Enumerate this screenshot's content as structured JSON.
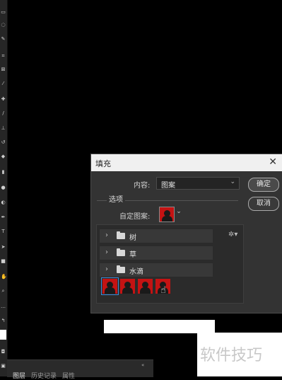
{
  "dialog": {
    "title": "填充",
    "content_label": "内容:",
    "content_value": "图案",
    "ok_label": "确定",
    "cancel_label": "取消",
    "options_label": "选项",
    "custom_pattern_label": "自定图案:",
    "folders": [
      "树",
      "草",
      "水滴"
    ],
    "pattern_count": 4
  },
  "bottom_panel": {
    "tabs": [
      "图层",
      "历史记录",
      "属性"
    ]
  },
  "watermark": {
    "text": "软件技巧"
  },
  "colors": {
    "pattern_red": "#c41313",
    "dialog_bg": "#333333",
    "selection_blue": "#3d8bd9"
  }
}
